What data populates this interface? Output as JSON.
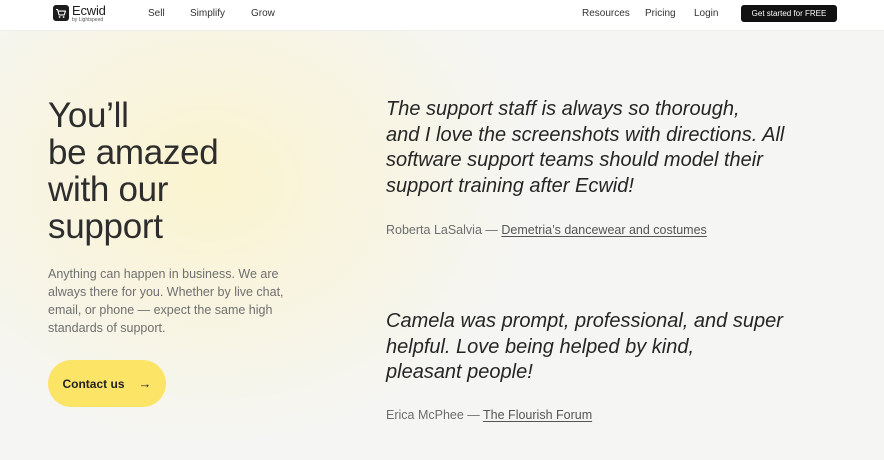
{
  "nav": {
    "logo_name": "Ecwid",
    "logo_sub": "by Lightspeed",
    "left_links": [
      "Sell",
      "Simplify",
      "Grow"
    ],
    "right_links": [
      "Resources",
      "Pricing",
      "Login"
    ],
    "cta_label": "Get started for FREE"
  },
  "hero": {
    "headline_lines": [
      "You’ll",
      "be amazed",
      "with our",
      "support"
    ],
    "lead_lines": [
      "Anything can happen in business. We are",
      "always there for you. Whether by live chat,",
      "email, or phone — expect the same high",
      "standards of support."
    ],
    "contact_label": "Contact us",
    "contact_arrow": "→"
  },
  "testimonials": [
    {
      "lines": [
        "The support staff is always so thorough,",
        "and I love the screenshots with directions. All",
        "software support teams should model their",
        "support training after Ecwid!"
      ],
      "author": "Roberta LaSalvia",
      "separator": "—",
      "business": "Demetria’s dancewear and costumes"
    },
    {
      "lines": [
        "Camela was prompt, professional, and super",
        "helpful. Love being helped by kind,",
        "pleasant people!"
      ],
      "author": "Erica McPhee",
      "separator": "—",
      "business": "The Flourish Forum"
    }
  ],
  "colors": {
    "accent_yellow": "#fbe466",
    "cta_dark": "#111111",
    "glow": "#fbf4cf"
  }
}
